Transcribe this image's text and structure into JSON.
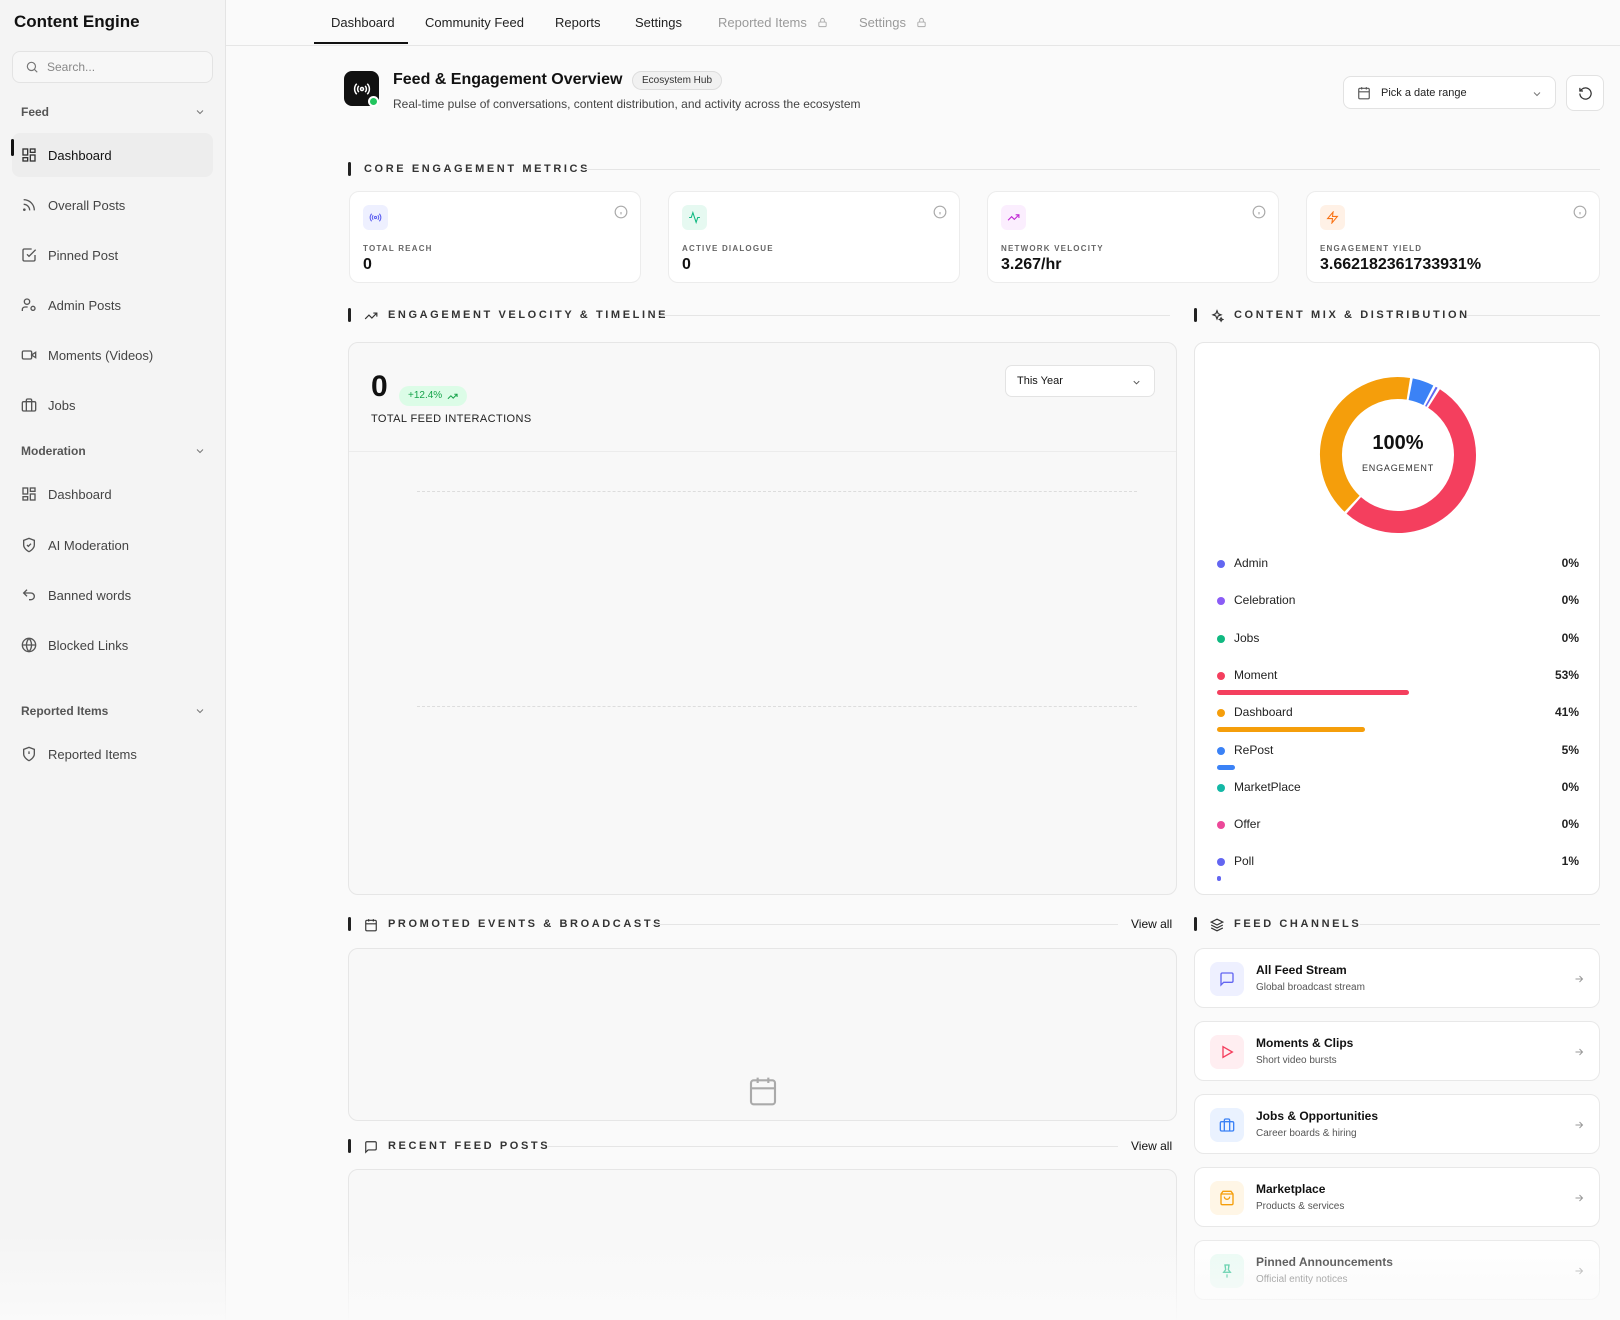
{
  "app": {
    "title": "Content Engine"
  },
  "search": {
    "placeholder": "Search..."
  },
  "sidebar": {
    "groups": [
      {
        "label": "Feed",
        "items": [
          {
            "label": "Dashboard",
            "icon": "grid-icon",
            "active": true
          },
          {
            "label": "Overall Posts",
            "icon": "rss-icon"
          },
          {
            "label": "Pinned Post",
            "icon": "check-square-icon"
          },
          {
            "label": "Admin Posts",
            "icon": "user-cog-icon"
          },
          {
            "label": "Moments (Videos)",
            "icon": "video-icon"
          },
          {
            "label": "Jobs",
            "icon": "briefcase-icon"
          }
        ]
      },
      {
        "label": "Moderation",
        "items": [
          {
            "label": "Dashboard",
            "icon": "grid-icon"
          },
          {
            "label": "AI Moderation",
            "icon": "shield-check-icon"
          },
          {
            "label": "Banned words",
            "icon": "undo-icon"
          },
          {
            "label": "Blocked Links",
            "icon": "globe-icon"
          }
        ]
      },
      {
        "label": "Reported Items",
        "items": [
          {
            "label": "Reported Items",
            "icon": "shield-alert-icon"
          }
        ]
      }
    ]
  },
  "topnav": {
    "tabs": [
      {
        "label": "Dashboard",
        "active": true
      },
      {
        "label": "Community Feed"
      },
      {
        "label": "Reports"
      },
      {
        "label": "Settings"
      },
      {
        "label": "Reported Items",
        "locked": true
      },
      {
        "label": "Settings",
        "locked": true
      }
    ]
  },
  "header": {
    "title": "Feed & Engagement Overview",
    "badge": "Ecosystem Hub",
    "subtitle": "Real-time pulse of conversations, content distribution, and activity across the ecosystem",
    "date_placeholder": "Pick a date range"
  },
  "metrics": {
    "section_title": "CORE ENGAGEMENT METRICS",
    "cards": [
      {
        "label": "TOTAL REACH",
        "value": "0",
        "icon": "broadcast-icon",
        "color": "#6366f1"
      },
      {
        "label": "ACTIVE DIALOGUE",
        "value": "0",
        "icon": "activity-icon",
        "color": "#10b981"
      },
      {
        "label": "NETWORK VELOCITY",
        "value": "3.267/hr",
        "icon": "trending-up-icon",
        "color": "#c026d3"
      },
      {
        "label": "ENGAGEMENT YIELD",
        "value": "3.662182361733931%",
        "icon": "zap-icon",
        "color": "#f97316"
      }
    ]
  },
  "velocity": {
    "section_title": "ENGAGEMENT VELOCITY & TIMELINE",
    "total": "0",
    "change": "+12.4%",
    "total_label": "TOTAL FEED INTERACTIONS",
    "period": "This Year"
  },
  "mix": {
    "section_title": "CONTENT MIX & DISTRIBUTION",
    "center_value": "100%",
    "center_label": "ENGAGEMENT",
    "chart_data": {
      "type": "pie",
      "categories": [
        "Admin",
        "Celebration",
        "Jobs",
        "Moment",
        "Dashboard",
        "RePost",
        "MarketPlace",
        "Offer",
        "Poll"
      ],
      "values": [
        0,
        0,
        0,
        53,
        41,
        5,
        0,
        0,
        1
      ],
      "labels": [
        "0%",
        "0%",
        "0%",
        "53%",
        "41%",
        "5%",
        "0%",
        "0%",
        "1%"
      ],
      "colors": [
        "#6366f1",
        "#8b5cf6",
        "#10b981",
        "#f43f5e",
        "#f59e0b",
        "#3b82f6",
        "#14b8a6",
        "#ec4899",
        "#6366f1"
      ]
    }
  },
  "events": {
    "section_title": "PROMOTED EVENTS & BROADCASTS",
    "view_all": "View all"
  },
  "posts": {
    "section_title": "RECENT FEED POSTS",
    "view_all": "View all"
  },
  "channels": {
    "section_title": "FEED CHANNELS",
    "items": [
      {
        "title": "All Feed Stream",
        "subtitle": "Global broadcast stream",
        "icon": "message-square-icon",
        "color": "#6366f1",
        "bg": "#eef0ff"
      },
      {
        "title": "Moments & Clips",
        "subtitle": "Short video bursts",
        "icon": "play-icon",
        "color": "#f43f5e",
        "bg": "#ffeef1"
      },
      {
        "title": "Jobs & Opportunities",
        "subtitle": "Career boards & hiring",
        "icon": "briefcase-icon",
        "color": "#3b82f6",
        "bg": "#eaf2ff"
      },
      {
        "title": "Marketplace",
        "subtitle": "Products & services",
        "icon": "shopping-bag-icon",
        "color": "#f59e0b",
        "bg": "#fff6e6"
      },
      {
        "title": "Pinned Announcements",
        "subtitle": "Official entity notices",
        "icon": "pin-icon",
        "color": "#10b981",
        "bg": "#e8fbf3"
      }
    ]
  }
}
